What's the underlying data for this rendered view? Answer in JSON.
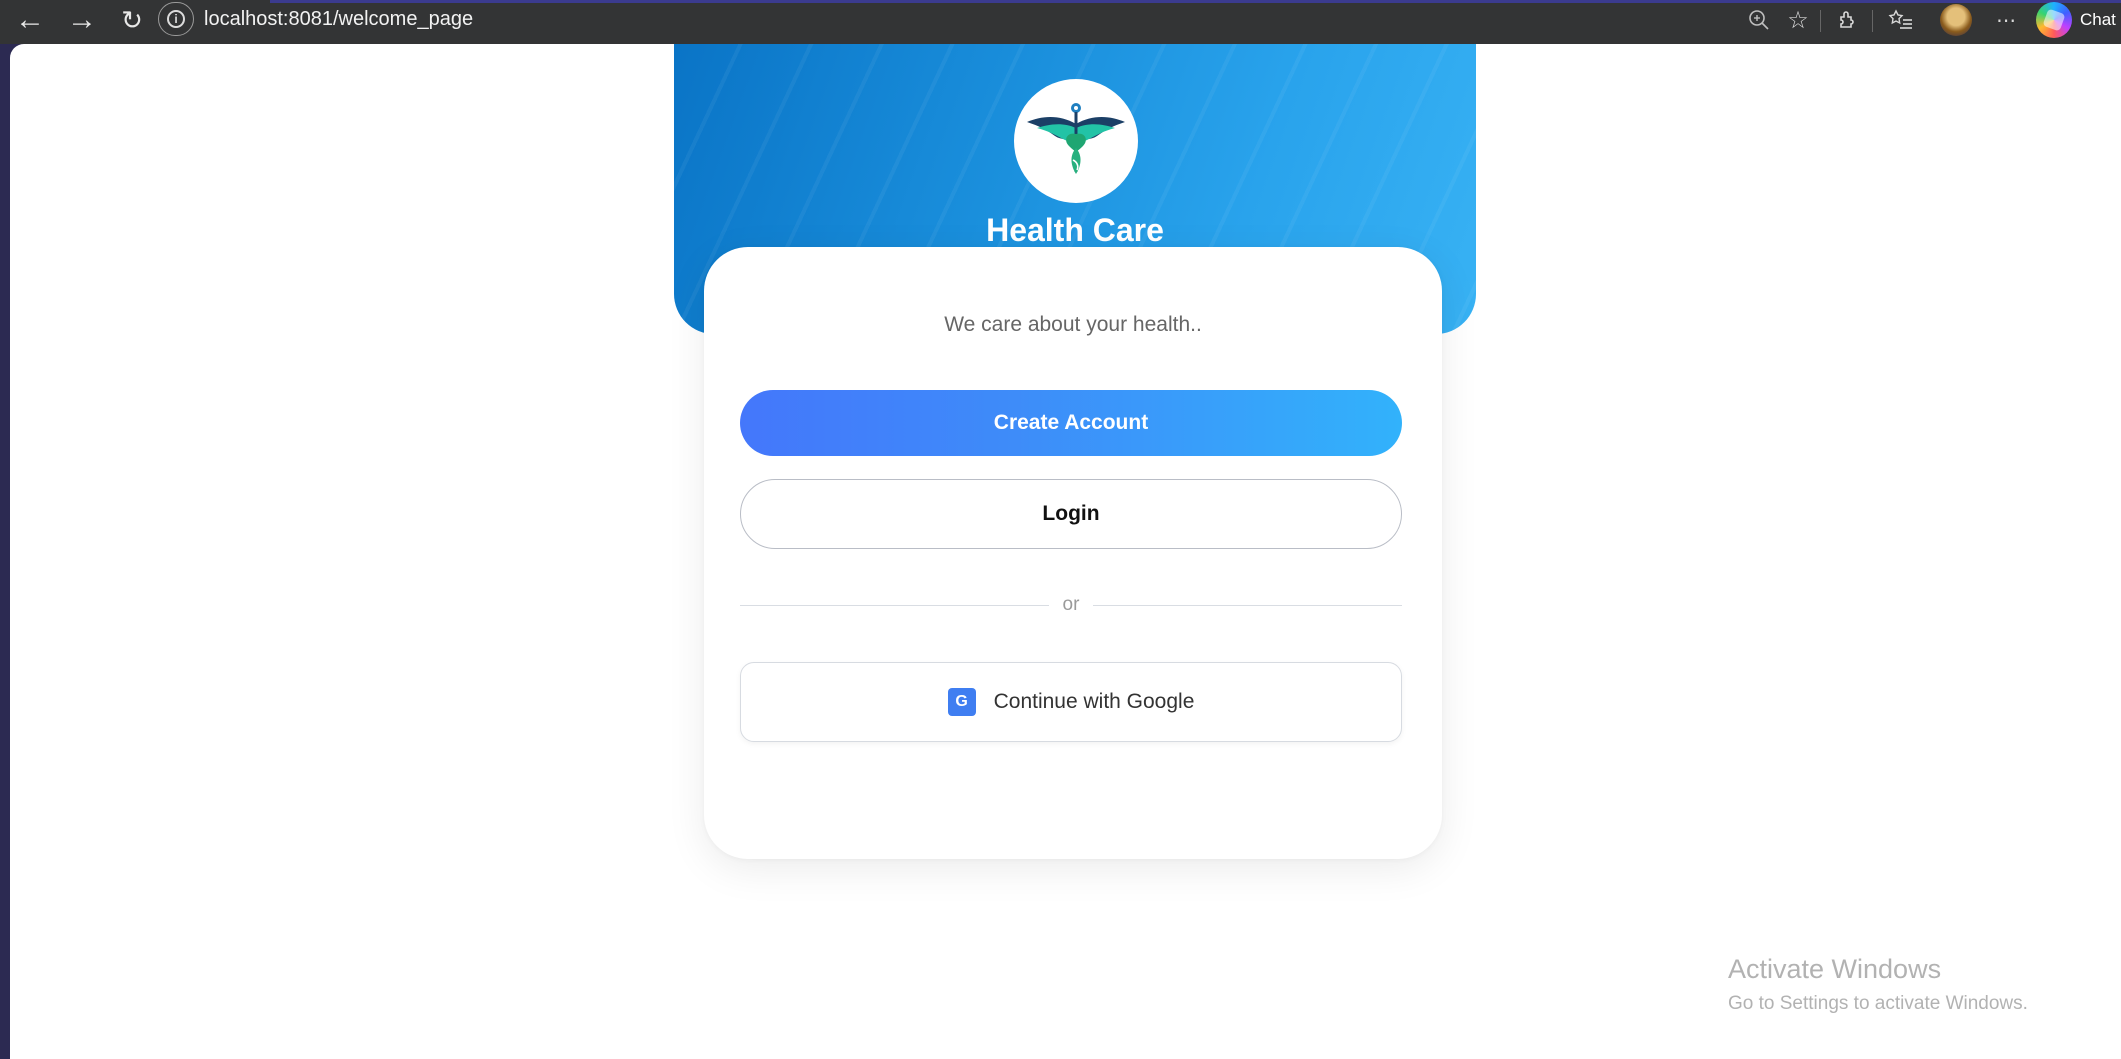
{
  "browser": {
    "url": "localhost:8081/welcome_page",
    "copilot_label": "Chat",
    "nav": {
      "back_icon": "arrow-left-icon",
      "forward_icon": "arrow-right-icon",
      "reload_icon": "reload-icon"
    },
    "toolbar_icons": [
      "zoom-icon",
      "favorite-star-icon",
      "extensions-icon",
      "favorites-list-icon",
      "profile-avatar",
      "more-icon",
      "copilot-icon"
    ]
  },
  "page": {
    "brand_name": "Health Care",
    "tagline": "We care about your health..",
    "create_account_label": "Create Account",
    "login_label": "Login",
    "divider_text": "or",
    "google_icon_letter": "G",
    "google_label": "Continue with Google"
  },
  "watermark": {
    "title": "Activate Windows",
    "subtitle": "Go to Settings to activate Windows."
  },
  "colors": {
    "hero_gradient_start": "#0a74c6",
    "hero_gradient_end": "#38b2f4",
    "primary_button_start": "#4477fb",
    "primary_button_end": "#32b2fb",
    "google_badge": "#3f7ef1"
  }
}
